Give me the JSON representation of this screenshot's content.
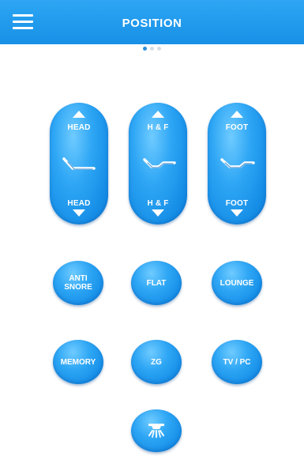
{
  "header": {
    "title": "POSITION",
    "menu_icon": "hamburger-menu-icon",
    "background": "#1f9bef"
  },
  "pager": {
    "pages": 3,
    "current": 1
  },
  "position_controls": [
    {
      "id": "head",
      "up_label": "HEAD",
      "down_label": "HEAD",
      "icon": "bed-head-raise-icon"
    },
    {
      "id": "hf",
      "up_label": "H & F",
      "down_label": "H & F",
      "icon": "bed-head-foot-raise-icon"
    },
    {
      "id": "foot",
      "up_label": "FOOT",
      "down_label": "FOOT",
      "icon": "bed-foot-raise-icon"
    }
  ],
  "presets_row1": [
    {
      "id": "anti-snore",
      "label": "ANTI\nSNORE"
    },
    {
      "id": "flat",
      "label": "FLAT"
    },
    {
      "id": "lounge",
      "label": "LOUNGE"
    }
  ],
  "presets_row2": [
    {
      "id": "memory",
      "label": "MEMORY"
    },
    {
      "id": "zg",
      "label": "ZG"
    },
    {
      "id": "tv-pc",
      "label": "TV / PC"
    }
  ],
  "light_button": {
    "icon": "underbed-light-icon"
  },
  "colors": {
    "button_blue": "#1a92e9",
    "button_highlight": "#6fcbff",
    "text": "#ffffff",
    "dot_active": "#2a8fe0",
    "dot_inactive": "#d6dde3"
  }
}
